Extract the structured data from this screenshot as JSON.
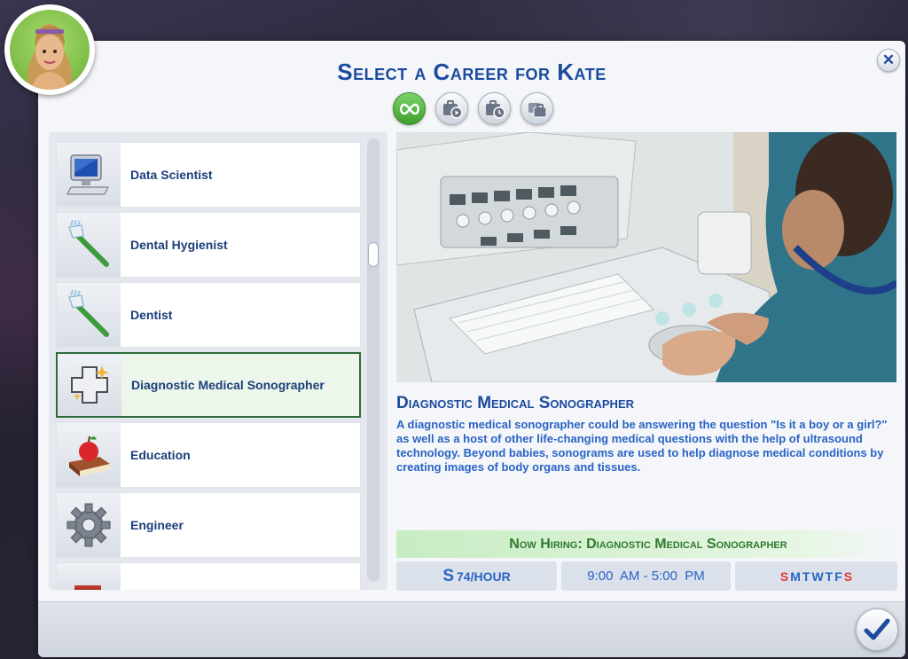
{
  "dialog": {
    "title": "Select a Career for Kate",
    "close_icon": "close-icon",
    "confirm_icon": "checkmark-icon"
  },
  "avatar": {
    "alt": "sim-portrait"
  },
  "filters": [
    {
      "icon": "infinity-icon",
      "active": true
    },
    {
      "icon": "briefcase-play-icon",
      "active": false
    },
    {
      "icon": "briefcase-clock-icon",
      "active": false
    },
    {
      "icon": "briefcases-icon",
      "active": false
    }
  ],
  "careers": [
    {
      "label": "Data Scientist",
      "icon": "computer-monitor-icon"
    },
    {
      "label": "Dental Hygienist",
      "icon": "toothbrush-icon"
    },
    {
      "label": "Dentist",
      "icon": "toothbrush-icon"
    },
    {
      "label": "Diagnostic Medical Sonographer",
      "icon": "medical-cross-icon",
      "selected": true
    },
    {
      "label": "Education",
      "icon": "apple-book-icon"
    },
    {
      "label": "Engineer",
      "icon": "gear-icon"
    },
    {
      "label": "",
      "icon": "partial-item-icon"
    }
  ],
  "detail": {
    "title": "Diagnostic Medical Sonographer",
    "description": "A diagnostic medical sonographer could be answering the question \"Is it a boy or a girl?\" as well as a host of other life-changing medical questions with the help of ultrasound technology. Beyond babies, sonograms are used to help diagnose medical conditions by creating images of body organs and tissues.",
    "hiring": "Now Hiring: Diagnostic Medical Sonographer",
    "pay_symbol": "S",
    "pay": "74/HOUR",
    "hours": "9:00  AM - 5:00  PM",
    "days": [
      "S",
      "M",
      "T",
      "W",
      "T",
      "F",
      "S"
    ]
  },
  "colors": {
    "title_blue": "#1b4a9e",
    "text_blue": "#2a64c4",
    "hiring_green": "#2f7a2c",
    "off_day_red": "#e0383a"
  }
}
